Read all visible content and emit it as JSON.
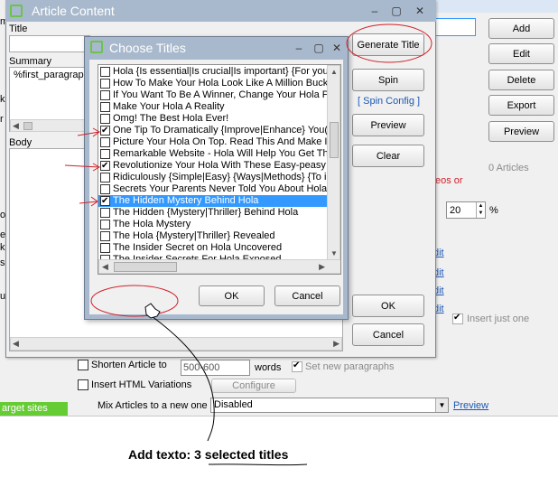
{
  "main_window": {
    "buttons": {
      "add": "Add",
      "edit": "Edit",
      "delete": "Delete",
      "export": "Export",
      "preview": "Preview"
    },
    "article_count": "0 Articles",
    "partial_text": "eos or",
    "percent_value": "20",
    "percent_sign": "%",
    "edit_links": [
      "dit",
      "dit",
      "dit",
      "dit"
    ],
    "insert_just_one": "Insert just one",
    "shorten_article_to": "Shorten Article to",
    "shorten_value": "500-600",
    "words": "words",
    "set_new_paragraphs": "Set new paragraphs",
    "insert_html_variations": "Insert HTML Variations",
    "configure": "Configure",
    "mix_articles": "Mix Articles to a new one",
    "mix_value": "Disabled",
    "preview_link": "Preview",
    "target_sites": "arget sites",
    "left_frags": [
      "m",
      "k",
      "r",
      "ok",
      "e",
      "k",
      "se",
      "ull"
    ]
  },
  "article_window": {
    "title": "Article Content",
    "title_label": "Title",
    "summary_label": "Summary",
    "summary_value": "%first_paragrap",
    "body_label": "Body",
    "buttons": {
      "generate": "Generate Title",
      "spin": "Spin",
      "spin_config": "[ Spin Config ]",
      "preview": "Preview",
      "clear": "Clear",
      "ok": "OK",
      "cancel": "Cancel"
    }
  },
  "dialog": {
    "title": "Choose Titles",
    "ok": "OK",
    "cancel": "Cancel",
    "items": [
      {
        "text": "Hola {Is essential|Is crucial|Is important} {For you",
        "checked": false,
        "selected": false
      },
      {
        "text": "How To Make Your Hola Look Like A Million Bucks",
        "checked": false,
        "selected": false
      },
      {
        "text": "If You Want To Be A Winner, Change Your Hola P",
        "checked": false,
        "selected": false
      },
      {
        "text": "Make Your Hola A Reality",
        "checked": false,
        "selected": false
      },
      {
        "text": "Omg! The Best Hola Ever!",
        "checked": false,
        "selected": false
      },
      {
        "text": "One Tip To Dramatically {Improve|Enhance} You(",
        "checked": true,
        "selected": false
      },
      {
        "text": "Picture Your Hola On Top. Read This And Make It",
        "checked": false,
        "selected": false
      },
      {
        "text": "Remarkable Website - Hola Will Help You Get The",
        "checked": false,
        "selected": false
      },
      {
        "text": "Revolutionize Your Hola With These Easy-peasy T",
        "checked": true,
        "selected": false
      },
      {
        "text": "Ridiculously {Simple|Easy} {Ways|Methods} {To i",
        "checked": false,
        "selected": false
      },
      {
        "text": "Secrets Your Parents Never Told You About Hola",
        "checked": false,
        "selected": false
      },
      {
        "text": "The Hidden Mystery Behind Hola",
        "checked": true,
        "selected": true
      },
      {
        "text": "The Hidden {Mystery|Thriller} Behind Hola",
        "checked": false,
        "selected": false
      },
      {
        "text": "The Hola Mystery",
        "checked": false,
        "selected": false
      },
      {
        "text": "The Hola {Mystery|Thriller} Revealed",
        "checked": false,
        "selected": false
      },
      {
        "text": "The Insider Secret on Hola Uncovered",
        "checked": false,
        "selected": false
      },
      {
        "text": "The Insider Secrets For Hola Exposed",
        "checked": false,
        "selected": false
      }
    ]
  },
  "annotation": {
    "text": "Add texto: 3 selected titles"
  },
  "colors": {
    "title_bar": "#a9b9cd",
    "annotation": "#d0202a",
    "accent": "#3399ff",
    "green": "#66cc33"
  }
}
